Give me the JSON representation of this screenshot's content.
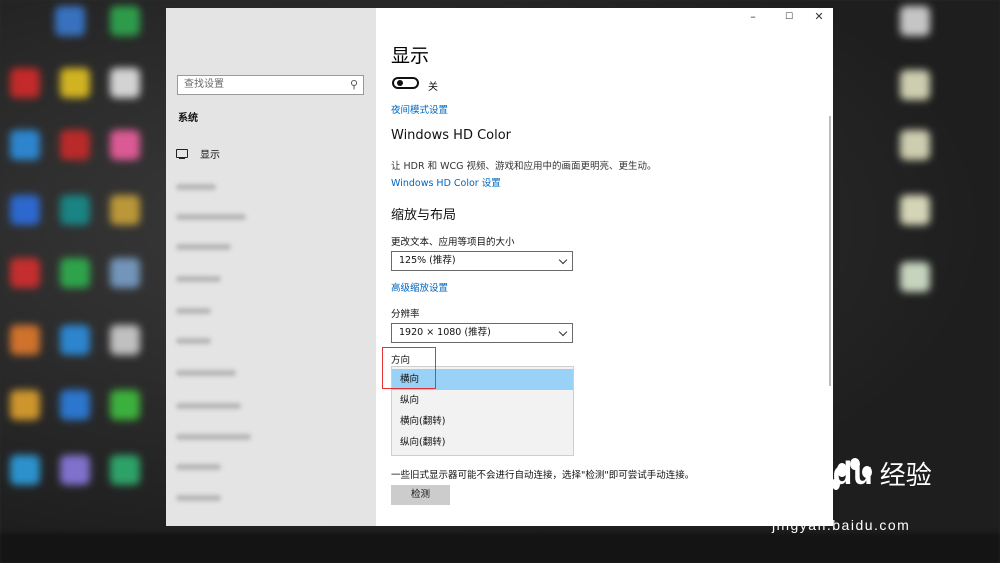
{
  "sidebar": {
    "search_placeholder": "查找设置",
    "section_title": "系统",
    "active_item": "显示"
  },
  "window": {
    "controls": {
      "minimize": "–",
      "maximize": "☐",
      "close": "✕"
    },
    "page_title": "显示",
    "night_light": {
      "toggle_state": "关",
      "settings_link": "夜间模式设置"
    },
    "hd_color": {
      "heading": "Windows HD Color",
      "description": "让 HDR 和 WCG 视频、游戏和应用中的画面更明亮、更生动。",
      "settings_link": "Windows HD Color 设置"
    },
    "scale_layout": {
      "heading": "缩放与布局",
      "scale_label": "更改文本、应用等项目的大小",
      "scale_value": "125% (推荐)",
      "advanced_link": "高级缩放设置",
      "resolution_label": "分辨率",
      "resolution_value": "1920 × 1080 (推荐)",
      "orientation_label": "方向",
      "orientation_options": [
        "横向",
        "纵向",
        "横向(翻转)",
        "纵向(翻转)"
      ],
      "orientation_selected": "横向"
    },
    "detect": {
      "description": "一些旧式显示器可能不会进行自动连接，选择\"检测\"即可尝试手动连接。",
      "button_label": "检测"
    }
  },
  "watermark": {
    "logo": "Bai du",
    "cn": "经验",
    "url": "jingyan.baidu.com"
  },
  "colors": {
    "accent_link": "#0067c0",
    "selected_option": "#99d1f7",
    "highlight_box": "#e53333"
  }
}
